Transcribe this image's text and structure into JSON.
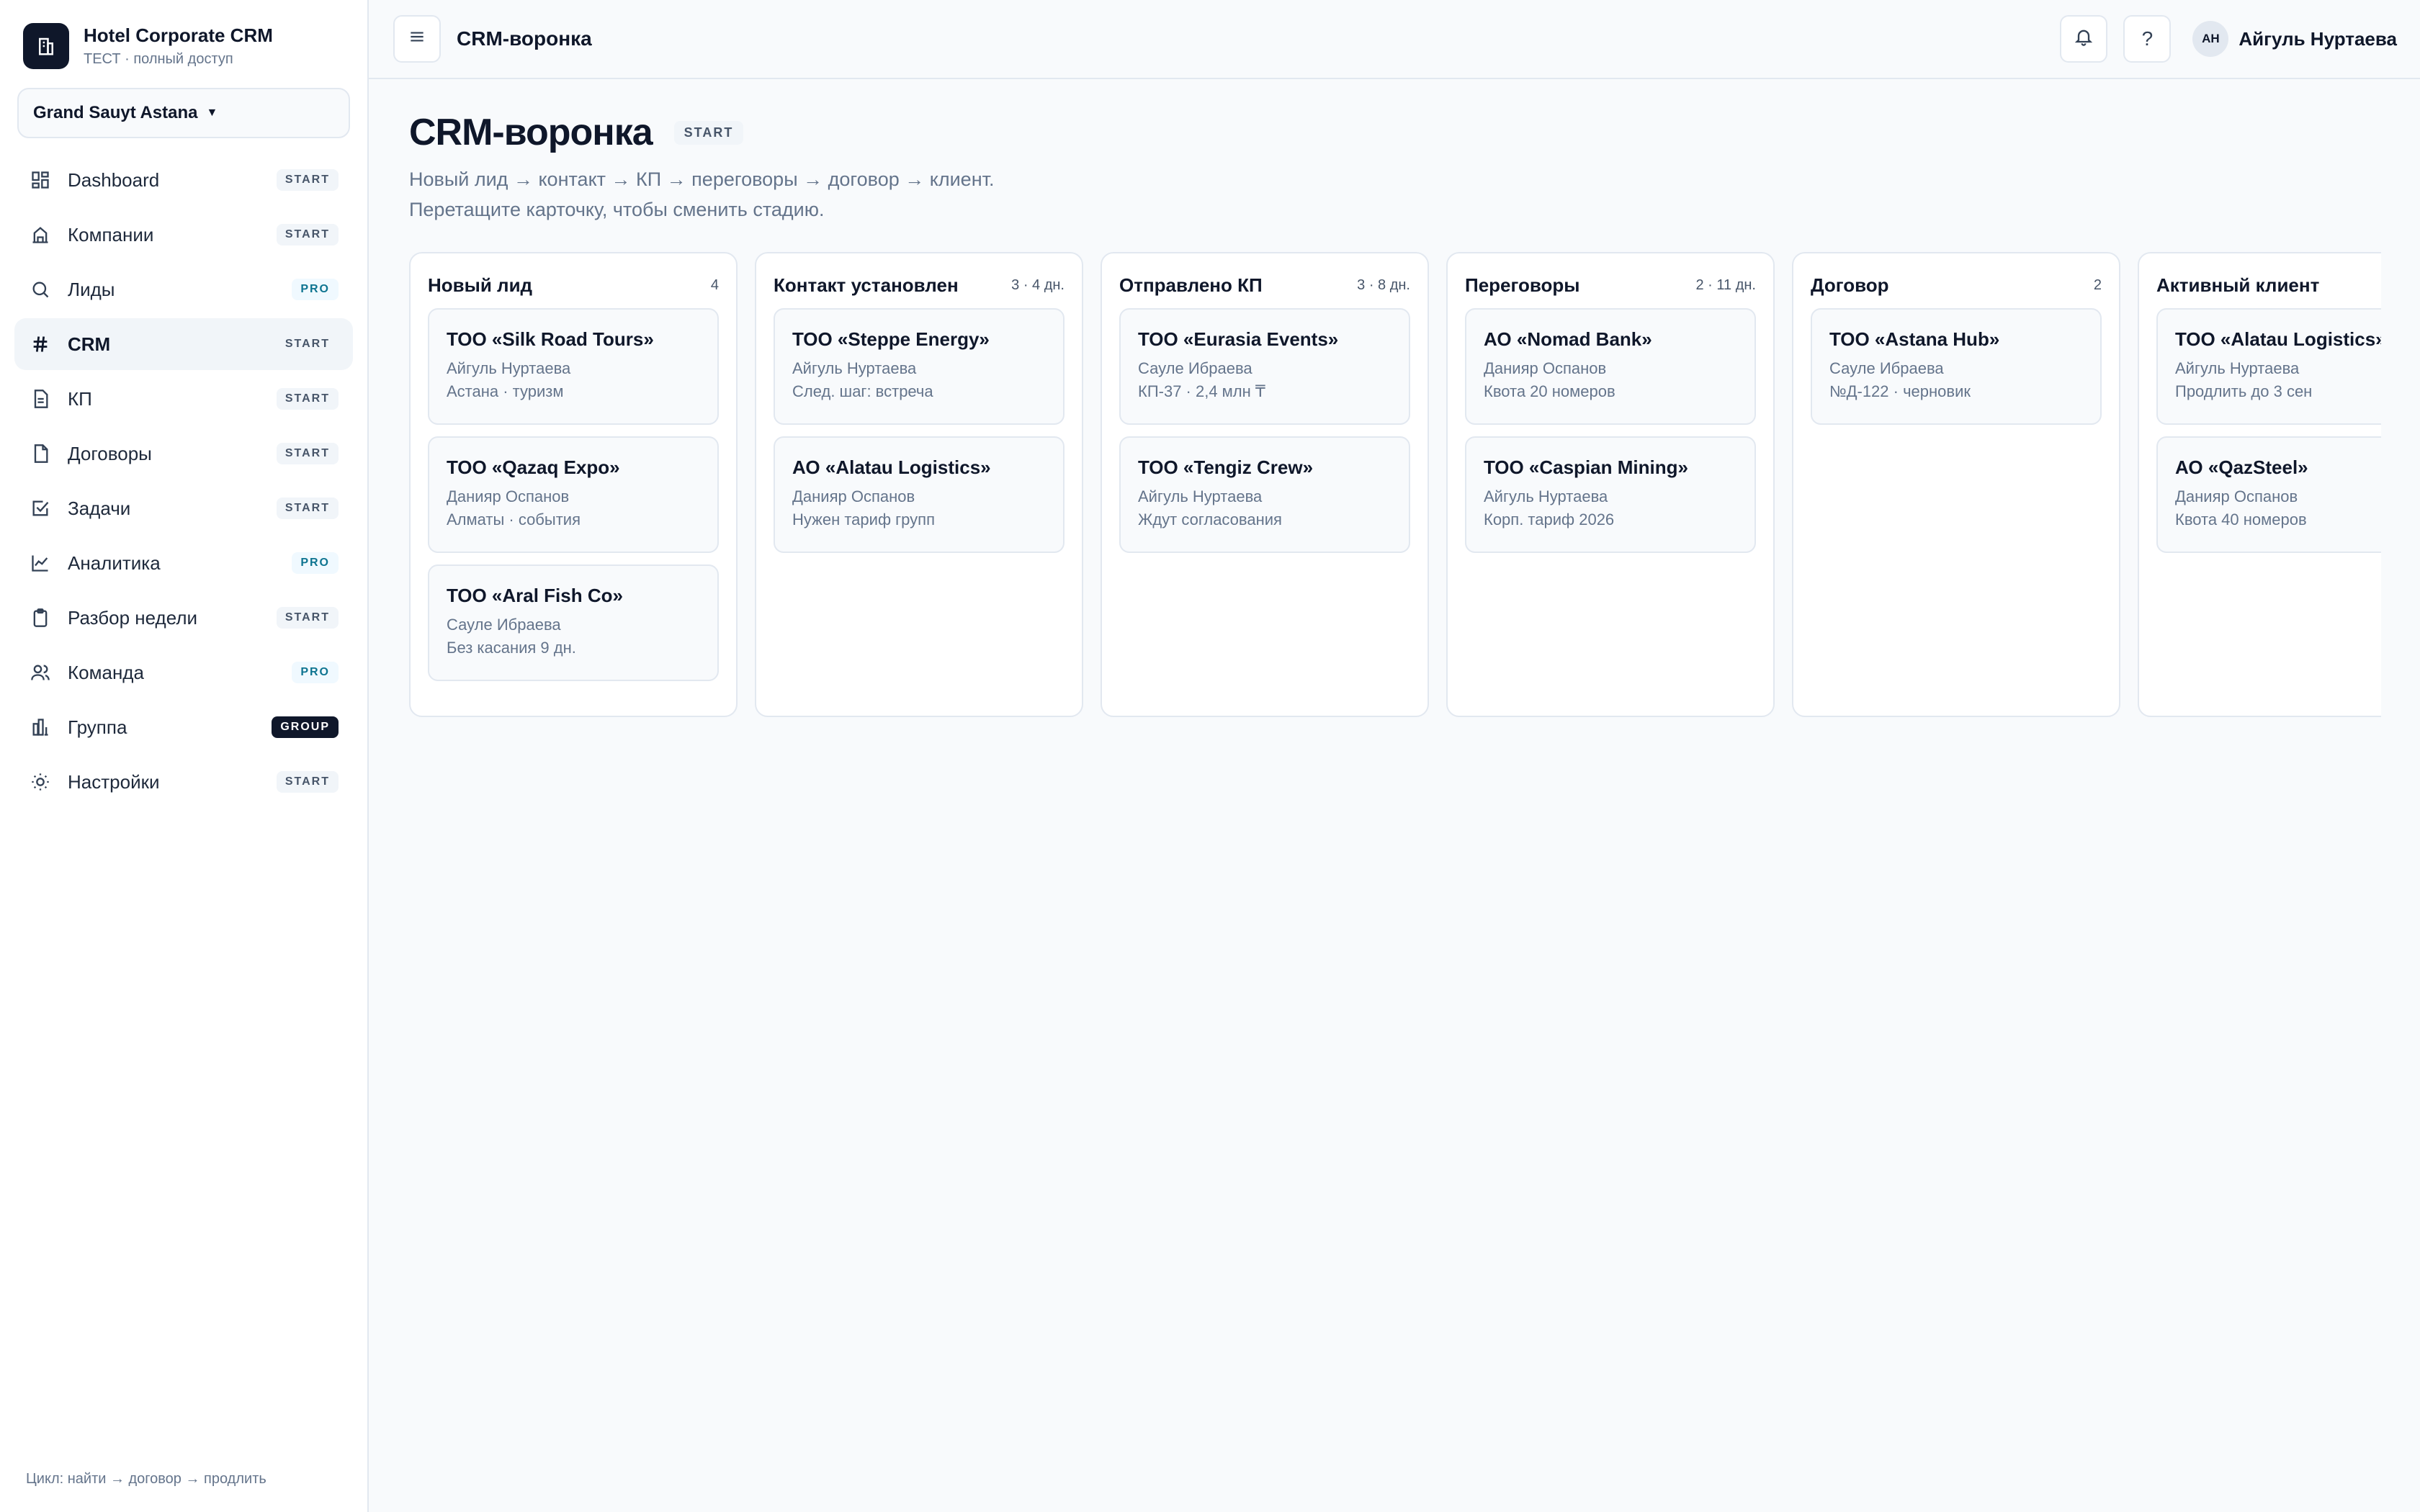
{
  "brand": {
    "name": "Hotel Corporate CRM",
    "subtitle": "ТЕСТ · полный доступ",
    "logo_icon": "building-icon"
  },
  "hotel_selector": {
    "value": "Grand Sauyt Astana"
  },
  "nav": [
    {
      "label": "Dashboard",
      "badge": "START",
      "icon": "grid-icon"
    },
    {
      "label": "Компании",
      "badge": "START",
      "icon": "building-icon"
    },
    {
      "label": "Лиды",
      "badge": "PRO",
      "icon": "search-icon"
    },
    {
      "label": "CRM",
      "badge": "START",
      "icon": "hash-icon",
      "active": true
    },
    {
      "label": "КП",
      "badge": "START",
      "icon": "document-icon"
    },
    {
      "label": "Договоры",
      "badge": "START",
      "icon": "file-icon"
    },
    {
      "label": "Задачи",
      "badge": "START",
      "icon": "check-square-icon"
    },
    {
      "label": "Аналитика",
      "badge": "PRO",
      "icon": "line-chart-icon"
    },
    {
      "label": "Разбор недели",
      "badge": "START",
      "icon": "clipboard-icon"
    },
    {
      "label": "Команда",
      "badge": "PRO",
      "icon": "users-icon"
    },
    {
      "label": "Группа",
      "badge": "GROUP",
      "icon": "bar-chart-icon"
    },
    {
      "label": "Настройки",
      "badge": "START",
      "icon": "sun-icon"
    }
  ],
  "sidebar_footer": "Цикл: найти → договор → продлить",
  "topbar": {
    "title": "CRM-воронка",
    "help_label": "?",
    "user_initials": "АН",
    "user_name": "Айгуль Нуртаева"
  },
  "page": {
    "title": "CRM-воронка",
    "badge": "START",
    "description_line1": "Новый лид → контакт → КП → переговоры → договор → клиент.",
    "description_line2": "Перетащите карточку, чтобы сменить стадию."
  },
  "columns": [
    {
      "title": "Новый лид",
      "meta": "4",
      "cards": [
        {
          "title": "ТОО «Silk Road Tours»",
          "line1": "Айгуль Нуртаева",
          "line2": "Астана · туризм"
        },
        {
          "title": "ТОО «Qazaq Expo»",
          "line1": "Данияр Оспанов",
          "line2": "Алматы · события"
        },
        {
          "title": "ТОО «Aral Fish Co»",
          "line1": "Сауле Ибраева",
          "line2": "Без касания 9 дн."
        }
      ]
    },
    {
      "title": "Контакт установлен",
      "meta": "3 · 4 дн.",
      "cards": [
        {
          "title": "ТОО «Steppe Energy»",
          "line1": "Айгуль Нуртаева",
          "line2": "След. шаг: встреча"
        },
        {
          "title": "АО «Alatau Logistics»",
          "line1": "Данияр Оспанов",
          "line2": "Нужен тариф групп"
        }
      ]
    },
    {
      "title": "Отправлено КП",
      "meta": "3 · 8 дн.",
      "cards": [
        {
          "title": "ТОО «Eurasia Events»",
          "line1": "Сауле Ибраева",
          "line2": "КП-37 · 2,4 млн ₸"
        },
        {
          "title": "ТОО «Tengiz Crew»",
          "line1": "Айгуль Нуртаева",
          "line2": "Ждут согласования"
        }
      ]
    },
    {
      "title": "Переговоры",
      "meta": "2 · 11 дн.",
      "cards": [
        {
          "title": "АО «Nomad Bank»",
          "line1": "Данияр Оспанов",
          "line2": "Квота 20 номеров"
        },
        {
          "title": "ТОО «Caspian Mining»",
          "line1": "Айгуль Нуртаева",
          "line2": "Корп. тариф 2026"
        }
      ]
    },
    {
      "title": "Договор",
      "meta": "2",
      "cards": [
        {
          "title": "ТОО «Astana Hub»",
          "line1": "Сауле Ибраева",
          "line2": "№Д-122 · черновик"
        }
      ]
    },
    {
      "title": "Активный клиент",
      "meta": "",
      "cards": [
        {
          "title": "ТОО «Alatau Logistics»",
          "line1": "Айгуль Нуртаева",
          "line2": "Продлить до 3 сен"
        },
        {
          "title": "АО «QazSteel»",
          "line1": "Данияр Оспанов",
          "line2": "Квота 40 номеров"
        }
      ]
    }
  ]
}
